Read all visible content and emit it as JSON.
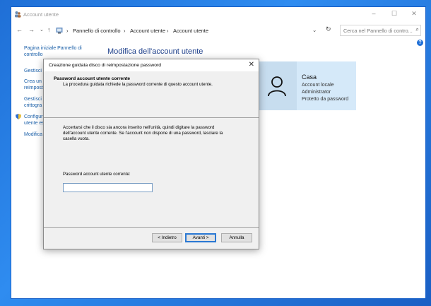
{
  "window": {
    "title": "Account utente",
    "controls": {
      "minimize": "–",
      "maximize": "☐",
      "close": "✕"
    }
  },
  "address_bar": {
    "back": "←",
    "forward": "→",
    "history": "⌄",
    "up": "↑",
    "breadcrumbs": [
      "Pannello di controllo",
      "Account utente",
      "Account utente"
    ],
    "separator": "›",
    "dropdown": "⌄",
    "refresh": "↻",
    "search_placeholder": "Cerca nel Pannello di contro...",
    "search_icon": "⌕"
  },
  "help_label": "?",
  "sidebar": {
    "items": [
      {
        "label": "Pagina iniziale Pannello di",
        "label2": "controllo"
      },
      {
        "label": "Gestisci l"
      },
      {
        "label": "Crea un c",
        "label2": "reimpost"
      },
      {
        "label": "Gestisci i",
        "label2": "crittogra"
      },
      {
        "label": "Configur",
        "label2": "utente es"
      },
      {
        "label": "Modifica"
      }
    ]
  },
  "main": {
    "title": "Modifica dell'account utente"
  },
  "user": {
    "name": "Casa",
    "type": "Account locale",
    "role": "Administrator",
    "protection": "Protetto da password"
  },
  "dialog": {
    "title": "Creazione guidata disco di reimpostazione password",
    "close": "✕",
    "header_title": "Password account utente corrente",
    "header_subtitle": "La procedura guidata richiede la password corrente di questo account utente.",
    "info": "Accertarsi che il disco sia ancora inserito nell'unità, quindi digitare la password dell'account utente corrente. Se l'account non dispone di una password, lasciare la casella vuota.",
    "password_label": "Password account utente corrente:",
    "password_value": "",
    "buttons": {
      "back": "< Indietro",
      "next": "Avanti >",
      "cancel": "Annulla"
    }
  },
  "colors": {
    "desktop": "#1f6fd6",
    "link": "#1a5fa8",
    "title": "#1c3e8a",
    "user_panel": "#d5e9f9",
    "primary_border": "#2a78d3"
  }
}
